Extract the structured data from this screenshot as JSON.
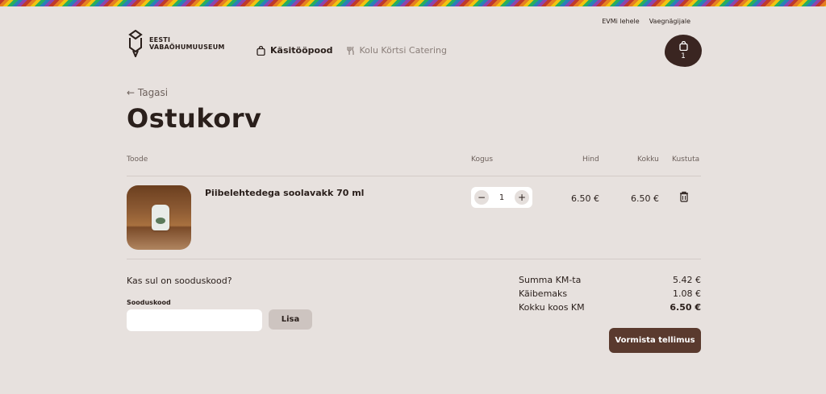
{
  "header": {
    "top_links": [
      "EVMi lehele",
      "Vaegnägijale"
    ],
    "logo_lines": [
      "EESTI",
      "VABAÕHUMUUSEUM"
    ],
    "nav": [
      {
        "label": "Käsitööpood",
        "icon": "bag-icon",
        "active": true
      },
      {
        "label": "Kolu Körtsi Catering",
        "icon": "utensils-icon",
        "active": false
      }
    ],
    "cart": {
      "icon": "bag-icon",
      "count": "1"
    }
  },
  "back_label": "← Tagasi",
  "page_title": "Ostukorv",
  "table": {
    "headers": {
      "product": "Toode",
      "qty": "Kogus",
      "price": "Hind",
      "total": "Kokku",
      "delete": "Kustuta"
    },
    "rows": [
      {
        "name": "Piibelehtedega soolavakk 70 ml",
        "qty": "1",
        "price": "6.50 €",
        "total": "6.50 €"
      }
    ]
  },
  "promo": {
    "question": "Kas sul on sooduskood?",
    "label": "Sooduskood",
    "placeholder": "",
    "button": "Lisa"
  },
  "summary": [
    {
      "label": "Summa KM-ta",
      "amount": "5.42 €"
    },
    {
      "label": "Käibemaks",
      "amount": "1.08 €"
    },
    {
      "label": "Kokku koos KM",
      "amount": "6.50 €"
    }
  ],
  "checkout_label": "Vormista tellimus",
  "colors": {
    "background": "#e7e1de",
    "brand_dark": "#3a2521",
    "button": "#5a3a2e"
  }
}
